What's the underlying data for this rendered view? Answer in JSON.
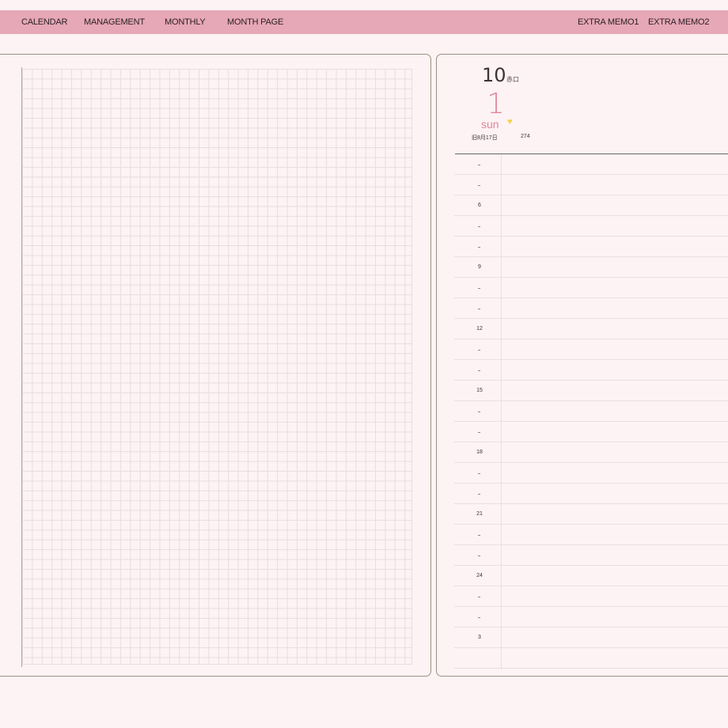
{
  "nav": {
    "left": [
      "CALENDAR",
      "MANAGEMENT",
      "MONTHLY",
      "MONTH PAGE"
    ],
    "right": [
      "EXTRA MEMO1",
      "EXTRA MEMO2"
    ]
  },
  "day_header": {
    "month": "10",
    "rokuyo": "赤口",
    "day": "1",
    "weekday": "sun",
    "lunar_date": "旧8月17日",
    "day_of_year": "274"
  },
  "time_labels": [
    "6",
    "9",
    "12",
    "15",
    "18",
    "21",
    "24",
    "3"
  ],
  "colors": {
    "topbar": "#e6a7b6",
    "accent": "#e0879c",
    "background": "#fdf3f4",
    "heart": "#f2d24a"
  },
  "icons": {
    "weather_mark": "heart-icon"
  }
}
